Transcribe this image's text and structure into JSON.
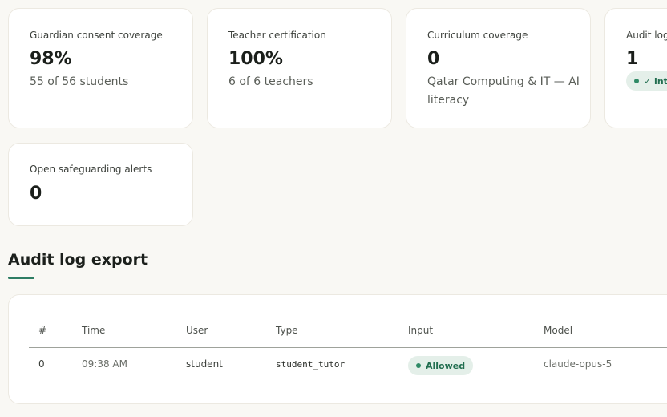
{
  "stats": [
    {
      "label": "Guardian consent coverage",
      "value": "98%",
      "sub": "55 of 56 students"
    },
    {
      "label": "Teacher certification",
      "value": "100%",
      "sub": "6 of 6 teachers"
    },
    {
      "label": "Curriculum coverage",
      "value": "0",
      "sub": "Qatar Computing & IT — AI literacy"
    },
    {
      "label": "Audit log",
      "value": "1",
      "badge": "✓ intact"
    },
    {
      "label": "Open safeguarding alerts",
      "value": "0"
    }
  ],
  "audit": {
    "title": "Audit log export",
    "columns": [
      "#",
      "Time",
      "User",
      "Type",
      "Input",
      "Model"
    ],
    "rows": [
      {
        "index": "0",
        "time": "09:38 AM",
        "user": "student",
        "type": "student_tutor",
        "input": "Allowed",
        "model": "claude-opus-5"
      }
    ]
  },
  "colors": {
    "accent": "#2e7d63",
    "pill_bg": "#e4efe9",
    "pill_text": "#226e50",
    "page_bg": "#f9f8f4"
  }
}
